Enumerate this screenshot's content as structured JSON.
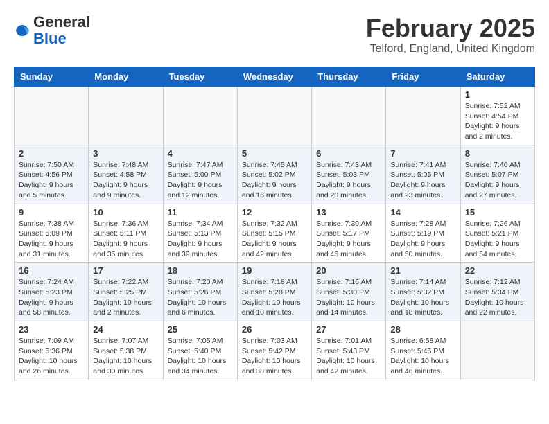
{
  "header": {
    "logo_general": "General",
    "logo_blue": "Blue",
    "title": "February 2025",
    "subtitle": "Telford, England, United Kingdom"
  },
  "calendar": {
    "days_of_week": [
      "Sunday",
      "Monday",
      "Tuesday",
      "Wednesday",
      "Thursday",
      "Friday",
      "Saturday"
    ],
    "weeks": [
      [
        {
          "day": "",
          "info": ""
        },
        {
          "day": "",
          "info": ""
        },
        {
          "day": "",
          "info": ""
        },
        {
          "day": "",
          "info": ""
        },
        {
          "day": "",
          "info": ""
        },
        {
          "day": "",
          "info": ""
        },
        {
          "day": "1",
          "info": "Sunrise: 7:52 AM\nSunset: 4:54 PM\nDaylight: 9 hours and 2 minutes."
        }
      ],
      [
        {
          "day": "2",
          "info": "Sunrise: 7:50 AM\nSunset: 4:56 PM\nDaylight: 9 hours and 5 minutes."
        },
        {
          "day": "3",
          "info": "Sunrise: 7:48 AM\nSunset: 4:58 PM\nDaylight: 9 hours and 9 minutes."
        },
        {
          "day": "4",
          "info": "Sunrise: 7:47 AM\nSunset: 5:00 PM\nDaylight: 9 hours and 12 minutes."
        },
        {
          "day": "5",
          "info": "Sunrise: 7:45 AM\nSunset: 5:02 PM\nDaylight: 9 hours and 16 minutes."
        },
        {
          "day": "6",
          "info": "Sunrise: 7:43 AM\nSunset: 5:03 PM\nDaylight: 9 hours and 20 minutes."
        },
        {
          "day": "7",
          "info": "Sunrise: 7:41 AM\nSunset: 5:05 PM\nDaylight: 9 hours and 23 minutes."
        },
        {
          "day": "8",
          "info": "Sunrise: 7:40 AM\nSunset: 5:07 PM\nDaylight: 9 hours and 27 minutes."
        }
      ],
      [
        {
          "day": "9",
          "info": "Sunrise: 7:38 AM\nSunset: 5:09 PM\nDaylight: 9 hours and 31 minutes."
        },
        {
          "day": "10",
          "info": "Sunrise: 7:36 AM\nSunset: 5:11 PM\nDaylight: 9 hours and 35 minutes."
        },
        {
          "day": "11",
          "info": "Sunrise: 7:34 AM\nSunset: 5:13 PM\nDaylight: 9 hours and 39 minutes."
        },
        {
          "day": "12",
          "info": "Sunrise: 7:32 AM\nSunset: 5:15 PM\nDaylight: 9 hours and 42 minutes."
        },
        {
          "day": "13",
          "info": "Sunrise: 7:30 AM\nSunset: 5:17 PM\nDaylight: 9 hours and 46 minutes."
        },
        {
          "day": "14",
          "info": "Sunrise: 7:28 AM\nSunset: 5:19 PM\nDaylight: 9 hours and 50 minutes."
        },
        {
          "day": "15",
          "info": "Sunrise: 7:26 AM\nSunset: 5:21 PM\nDaylight: 9 hours and 54 minutes."
        }
      ],
      [
        {
          "day": "16",
          "info": "Sunrise: 7:24 AM\nSunset: 5:23 PM\nDaylight: 9 hours and 58 minutes."
        },
        {
          "day": "17",
          "info": "Sunrise: 7:22 AM\nSunset: 5:25 PM\nDaylight: 10 hours and 2 minutes."
        },
        {
          "day": "18",
          "info": "Sunrise: 7:20 AM\nSunset: 5:26 PM\nDaylight: 10 hours and 6 minutes."
        },
        {
          "day": "19",
          "info": "Sunrise: 7:18 AM\nSunset: 5:28 PM\nDaylight: 10 hours and 10 minutes."
        },
        {
          "day": "20",
          "info": "Sunrise: 7:16 AM\nSunset: 5:30 PM\nDaylight: 10 hours and 14 minutes."
        },
        {
          "day": "21",
          "info": "Sunrise: 7:14 AM\nSunset: 5:32 PM\nDaylight: 10 hours and 18 minutes."
        },
        {
          "day": "22",
          "info": "Sunrise: 7:12 AM\nSunset: 5:34 PM\nDaylight: 10 hours and 22 minutes."
        }
      ],
      [
        {
          "day": "23",
          "info": "Sunrise: 7:09 AM\nSunset: 5:36 PM\nDaylight: 10 hours and 26 minutes."
        },
        {
          "day": "24",
          "info": "Sunrise: 7:07 AM\nSunset: 5:38 PM\nDaylight: 10 hours and 30 minutes."
        },
        {
          "day": "25",
          "info": "Sunrise: 7:05 AM\nSunset: 5:40 PM\nDaylight: 10 hours and 34 minutes."
        },
        {
          "day": "26",
          "info": "Sunrise: 7:03 AM\nSunset: 5:42 PM\nDaylight: 10 hours and 38 minutes."
        },
        {
          "day": "27",
          "info": "Sunrise: 7:01 AM\nSunset: 5:43 PM\nDaylight: 10 hours and 42 minutes."
        },
        {
          "day": "28",
          "info": "Sunrise: 6:58 AM\nSunset: 5:45 PM\nDaylight: 10 hours and 46 minutes."
        },
        {
          "day": "",
          "info": ""
        }
      ]
    ]
  }
}
